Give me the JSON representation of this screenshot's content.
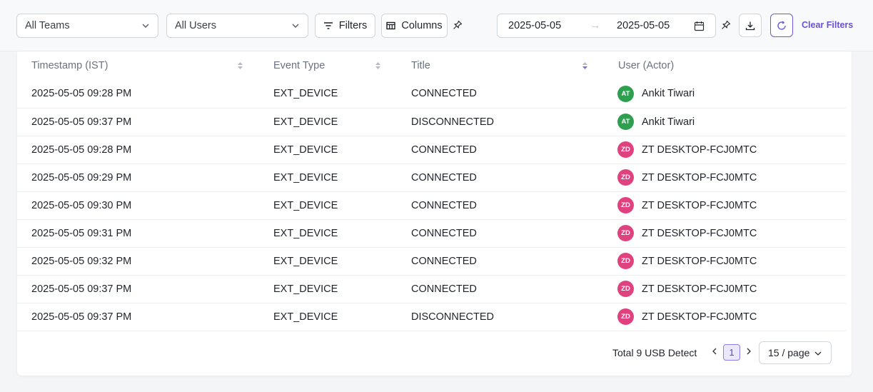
{
  "toolbar": {
    "teams_select": "All Teams",
    "users_select": "All Users",
    "filters_label": "Filters",
    "columns_label": "Columns",
    "date_from": "2025-05-05",
    "date_arrow": "→",
    "date_to": "2025-05-05",
    "clear_filters": "Clear Filters"
  },
  "table": {
    "columns": [
      "Timestamp (IST)",
      "Event Type",
      "Title",
      "User (Actor)"
    ],
    "rows": [
      {
        "timestamp": "2025-05-05 09:28 PM",
        "event_type": "EXT_DEVICE",
        "title": "CONNECTED",
        "avatar": "AT",
        "avatar_color": "#2e9e4f",
        "user": "Ankit Tiwari"
      },
      {
        "timestamp": "2025-05-05 09:37 PM",
        "event_type": "EXT_DEVICE",
        "title": "DISCONNECTED",
        "avatar": "AT",
        "avatar_color": "#2e9e4f",
        "user": "Ankit Tiwari"
      },
      {
        "timestamp": "2025-05-05 09:28 PM",
        "event_type": "EXT_DEVICE",
        "title": "CONNECTED",
        "avatar": "ZD",
        "avatar_color": "#e0417f",
        "user": "ZT DESKTOP-FCJ0MTC"
      },
      {
        "timestamp": "2025-05-05 09:29 PM",
        "event_type": "EXT_DEVICE",
        "title": "CONNECTED",
        "avatar": "ZD",
        "avatar_color": "#e0417f",
        "user": "ZT DESKTOP-FCJ0MTC"
      },
      {
        "timestamp": "2025-05-05 09:30 PM",
        "event_type": "EXT_DEVICE",
        "title": "CONNECTED",
        "avatar": "ZD",
        "avatar_color": "#e0417f",
        "user": "ZT DESKTOP-FCJ0MTC"
      },
      {
        "timestamp": "2025-05-05 09:31 PM",
        "event_type": "EXT_DEVICE",
        "title": "CONNECTED",
        "avatar": "ZD",
        "avatar_color": "#e0417f",
        "user": "ZT DESKTOP-FCJ0MTC"
      },
      {
        "timestamp": "2025-05-05 09:32 PM",
        "event_type": "EXT_DEVICE",
        "title": "CONNECTED",
        "avatar": "ZD",
        "avatar_color": "#e0417f",
        "user": "ZT DESKTOP-FCJ0MTC"
      },
      {
        "timestamp": "2025-05-05 09:37 PM",
        "event_type": "EXT_DEVICE",
        "title": "CONNECTED",
        "avatar": "ZD",
        "avatar_color": "#e0417f",
        "user": "ZT DESKTOP-FCJ0MTC"
      },
      {
        "timestamp": "2025-05-05 09:37 PM",
        "event_type": "EXT_DEVICE",
        "title": "DISCONNECTED",
        "avatar": "ZD",
        "avatar_color": "#e0417f",
        "user": "ZT DESKTOP-FCJ0MTC"
      }
    ]
  },
  "pagination": {
    "total_text": "Total 9 USB Detect",
    "current_page": "1",
    "page_size": "15 / page"
  },
  "colors": {
    "accent": "#6b4fd8",
    "sort_active": "#7b6fe0"
  }
}
